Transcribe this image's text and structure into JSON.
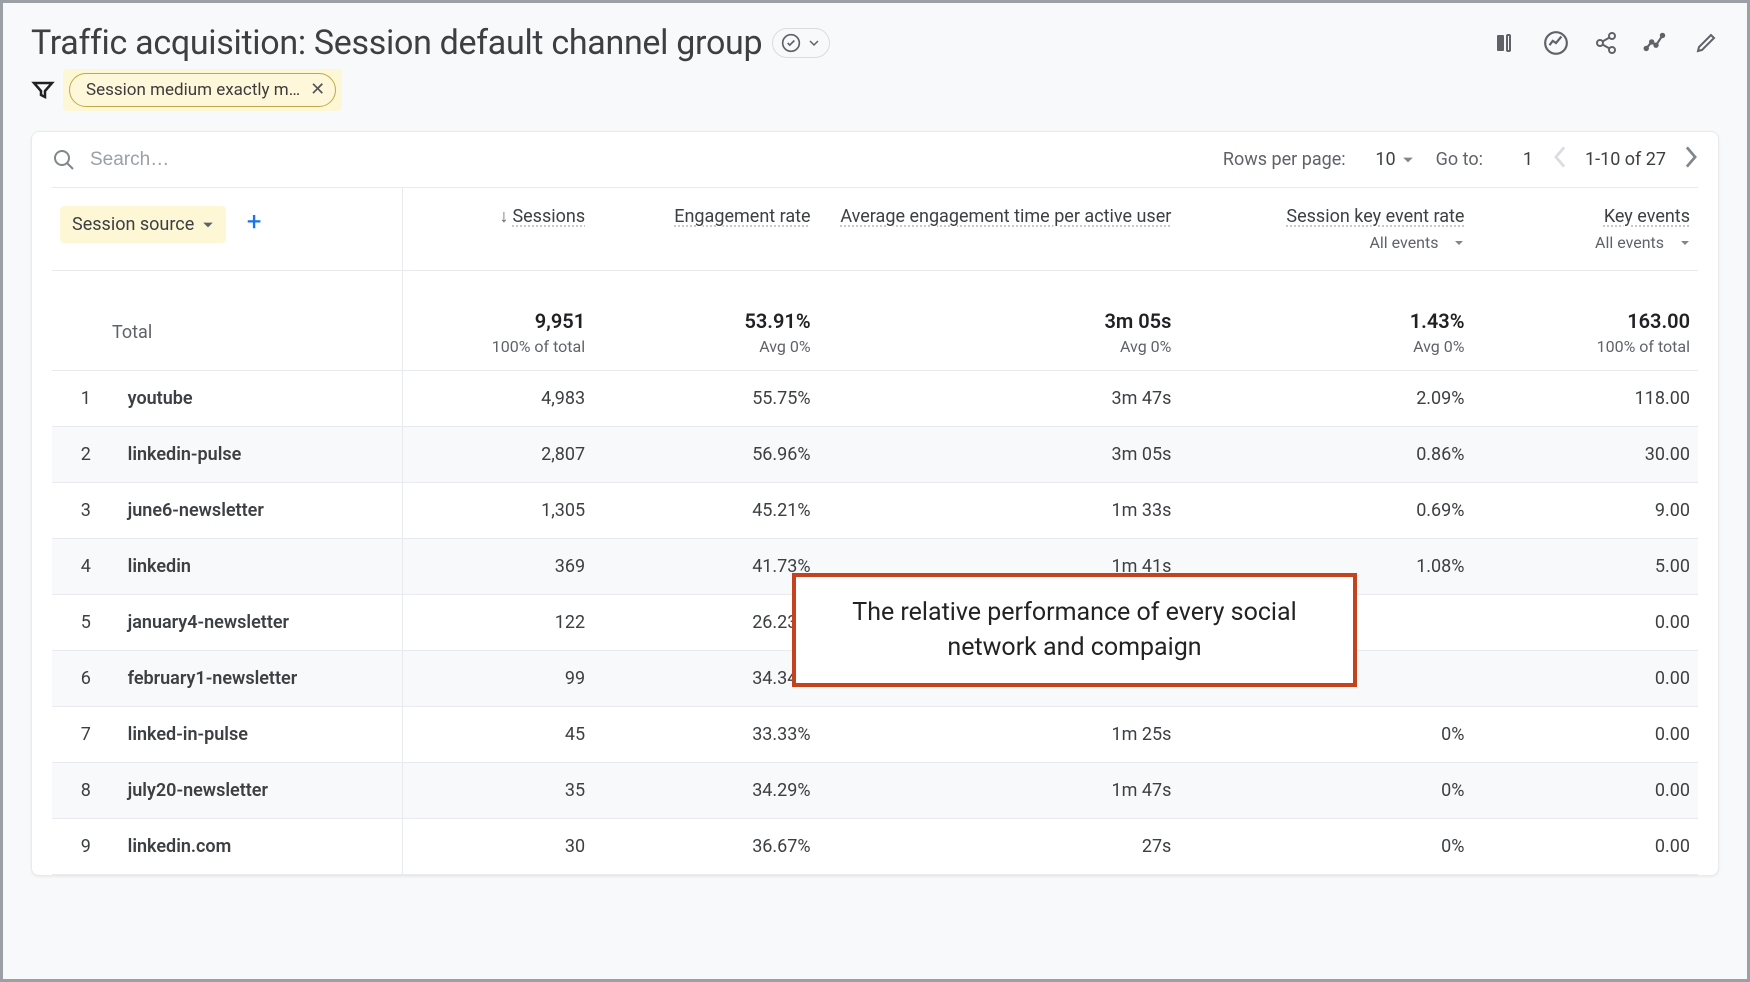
{
  "header": {
    "title": "Traffic acquisition: Session default channel group"
  },
  "filter": {
    "chip_label": "Session medium exactly m…"
  },
  "controls": {
    "search_placeholder": "Search…",
    "rows_per_page_label": "Rows per page:",
    "rows_per_page_value": "10",
    "goto_label": "Go to:",
    "goto_value": "1",
    "range_label": "1-10 of 27"
  },
  "columns": {
    "dimension_label": "Session source",
    "c1": "Sessions",
    "c2": "Engagement rate",
    "c3": "Average engagement time per active user",
    "c4": "Session key event rate",
    "c4_sub": "All events",
    "c5": "Key events",
    "c5_sub": "All events"
  },
  "totals": {
    "label": "Total",
    "c1": "9,951",
    "c1_sub": "100% of total",
    "c2": "53.91%",
    "c2_sub": "Avg 0%",
    "c3": "3m 05s",
    "c3_sub": "Avg 0%",
    "c4": "1.43%",
    "c4_sub": "Avg 0%",
    "c5": "163.00",
    "c5_sub": "100% of total"
  },
  "rows": [
    {
      "n": "1",
      "dim": "youtube",
      "c1": "4,983",
      "c2": "55.75%",
      "c3": "3m 47s",
      "c4": "2.09%",
      "c5": "118.00"
    },
    {
      "n": "2",
      "dim": "linkedin-pulse",
      "c1": "2,807",
      "c2": "56.96%",
      "c3": "3m 05s",
      "c4": "0.86%",
      "c5": "30.00"
    },
    {
      "n": "3",
      "dim": "june6-newsletter",
      "c1": "1,305",
      "c2": "45.21%",
      "c3": "1m 33s",
      "c4": "0.69%",
      "c5": "9.00"
    },
    {
      "n": "4",
      "dim": "linkedin",
      "c1": "369",
      "c2": "41.73%",
      "c3": "1m 41s",
      "c4": "1.08%",
      "c5": "5.00"
    },
    {
      "n": "5",
      "dim": "january4-newsletter",
      "c1": "122",
      "c2": "26.23%",
      "c3": "",
      "c4": "",
      "c5": "0.00"
    },
    {
      "n": "6",
      "dim": "february1-newsletter",
      "c1": "99",
      "c2": "34.34%",
      "c3": "",
      "c4": "",
      "c5": "0.00"
    },
    {
      "n": "7",
      "dim": "linked-in-pulse",
      "c1": "45",
      "c2": "33.33%",
      "c3": "1m 25s",
      "c4": "0%",
      "c5": "0.00"
    },
    {
      "n": "8",
      "dim": "july20-newsletter",
      "c1": "35",
      "c2": "34.29%",
      "c3": "1m 47s",
      "c4": "0%",
      "c5": "0.00"
    },
    {
      "n": "9",
      "dim": "linkedin.com",
      "c1": "30",
      "c2": "36.67%",
      "c3": "27s",
      "c4": "0%",
      "c5": "0.00"
    }
  ],
  "annotation": "The relative performance of every social network and compaign"
}
